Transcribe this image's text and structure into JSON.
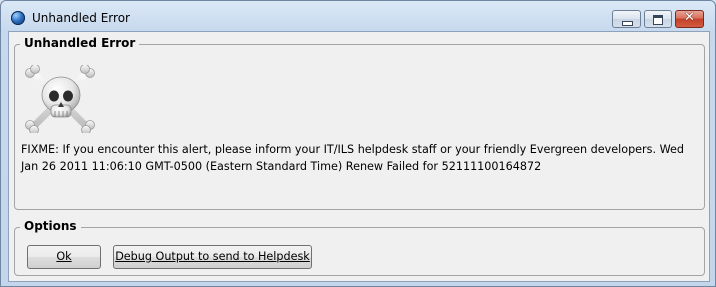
{
  "window": {
    "title": "Unhandled Error",
    "icon": "globe-icon",
    "controls": {
      "minimize": "minimize-icon",
      "maximize": "maximize-icon",
      "close": "close-icon",
      "close_glyph": "✕"
    }
  },
  "error_group": {
    "legend": "Unhandled Error",
    "image": "skull-and-crossbones-icon",
    "message": "FIXME: If you encounter this alert, please inform your IT/ILS helpdesk staff or your friendly Evergreen developers. Wed Jan 26 2011 11:06:10 GMT-0500 (Eastern Standard Time) Renew Failed for 52111100164872"
  },
  "options_group": {
    "legend": "Options",
    "buttons": [
      {
        "label": "Ok"
      },
      {
        "label": "Debug Output to send to Helpdesk"
      }
    ]
  }
}
